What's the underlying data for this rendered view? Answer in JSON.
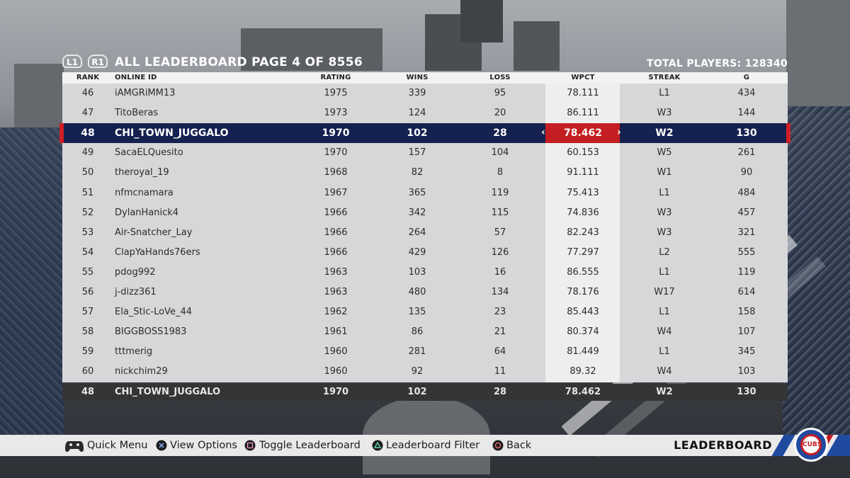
{
  "header": {
    "l1_label": "L1",
    "r1_label": "R1",
    "title": "ALL LEADERBOARD PAGE 4 OF 8556",
    "total_players": "TOTAL PLAYERS: 128340"
  },
  "columns": {
    "rank": "RANK",
    "online_id": "ONLINE ID",
    "rating": "RATING",
    "wins": "WINS",
    "loss": "LOSS",
    "wpct": "WPCT",
    "streak": "STREAK",
    "g": "G"
  },
  "rows": [
    {
      "rank": "46",
      "id": "iAMGRiMM13",
      "rating": "1975",
      "wins": "339",
      "loss": "95",
      "wpct": "78.111",
      "streak": "L1",
      "g": "434"
    },
    {
      "rank": "47",
      "id": "TitoBeras",
      "rating": "1973",
      "wins": "124",
      "loss": "20",
      "wpct": "86.111",
      "streak": "W3",
      "g": "144"
    },
    {
      "rank": "48",
      "id": "CHI_TOWN_JUGGALO",
      "rating": "1970",
      "wins": "102",
      "loss": "28",
      "wpct": "78.462",
      "streak": "W2",
      "g": "130"
    },
    {
      "rank": "49",
      "id": "SacaELQuesito",
      "rating": "1970",
      "wins": "157",
      "loss": "104",
      "wpct": "60.153",
      "streak": "W5",
      "g": "261"
    },
    {
      "rank": "50",
      "id": "theroyal_19",
      "rating": "1968",
      "wins": "82",
      "loss": "8",
      "wpct": "91.111",
      "streak": "W1",
      "g": "90"
    },
    {
      "rank": "51",
      "id": "nfmcnamara",
      "rating": "1967",
      "wins": "365",
      "loss": "119",
      "wpct": "75.413",
      "streak": "L1",
      "g": "484"
    },
    {
      "rank": "52",
      "id": "DylanHanick4",
      "rating": "1966",
      "wins": "342",
      "loss": "115",
      "wpct": "74.836",
      "streak": "W3",
      "g": "457"
    },
    {
      "rank": "53",
      "id": "Air-Snatcher_Lay",
      "rating": "1966",
      "wins": "264",
      "loss": "57",
      "wpct": "82.243",
      "streak": "W3",
      "g": "321"
    },
    {
      "rank": "54",
      "id": "ClapYaHands76ers",
      "rating": "1966",
      "wins": "429",
      "loss": "126",
      "wpct": "77.297",
      "streak": "L2",
      "g": "555"
    },
    {
      "rank": "55",
      "id": "pdog992",
      "rating": "1963",
      "wins": "103",
      "loss": "16",
      "wpct": "86.555",
      "streak": "L1",
      "g": "119"
    },
    {
      "rank": "56",
      "id": "j-dizz361",
      "rating": "1963",
      "wins": "480",
      "loss": "134",
      "wpct": "78.176",
      "streak": "W17",
      "g": "614"
    },
    {
      "rank": "57",
      "id": "Ela_Stic-LoVe_44",
      "rating": "1962",
      "wins": "135",
      "loss": "23",
      "wpct": "85.443",
      "streak": "L1",
      "g": "158"
    },
    {
      "rank": "58",
      "id": "BIGGBOSS1983",
      "rating": "1961",
      "wins": "86",
      "loss": "21",
      "wpct": "80.374",
      "streak": "W4",
      "g": "107"
    },
    {
      "rank": "59",
      "id": "tttmerig",
      "rating": "1960",
      "wins": "281",
      "loss": "64",
      "wpct": "81.449",
      "streak": "L1",
      "g": "345"
    },
    {
      "rank": "60",
      "id": "nickchim29",
      "rating": "1960",
      "wins": "92",
      "loss": "11",
      "wpct": "89.32",
      "streak": "W4",
      "g": "103"
    }
  ],
  "selected_index": 2,
  "my_row": {
    "rank": "48",
    "id": "CHI_TOWN_JUGGALO",
    "rating": "1970",
    "wins": "102",
    "loss": "28",
    "wpct": "78.462",
    "streak": "W2",
    "g": "130"
  },
  "footer": {
    "quick_menu": "Quick Menu",
    "view_options": "View Options",
    "toggle_leaderboard": "Toggle Leaderboard",
    "leaderboard_filter": "Leaderboard Filter",
    "back": "Back",
    "screen_title": "LEADERBOARD",
    "logo_text": "CUBS"
  },
  "colors": {
    "selected_row": "#15214f",
    "accent_red": "#c41e22",
    "team_blue": "#1f4aa0"
  }
}
